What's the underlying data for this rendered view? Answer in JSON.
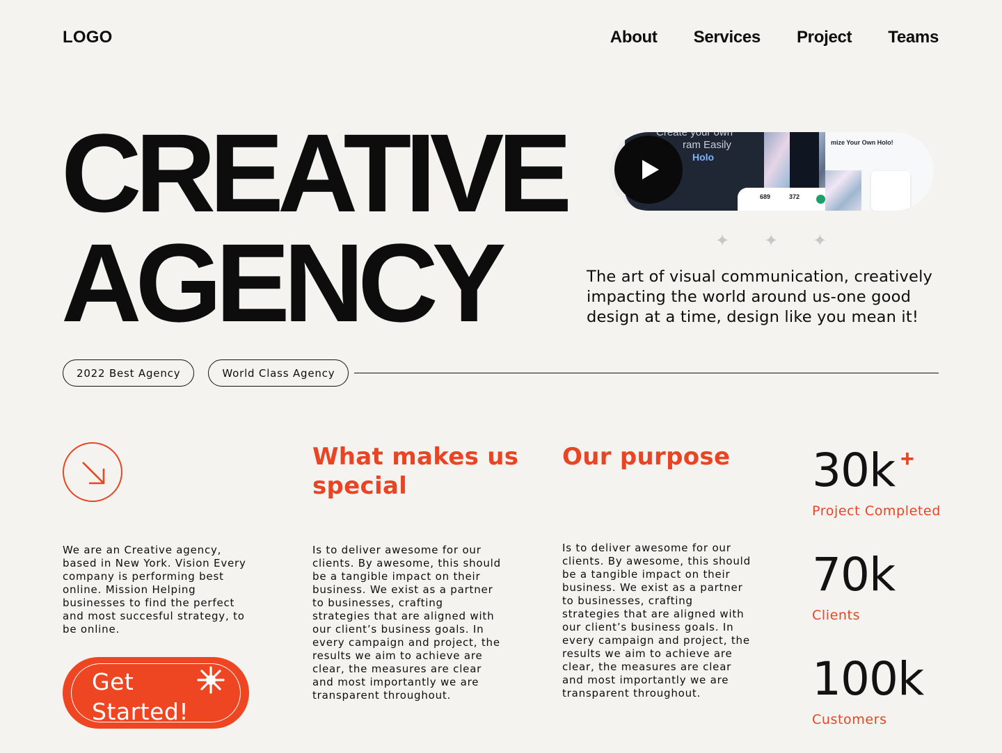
{
  "header": {
    "logo": "LOGO",
    "nav": [
      "About",
      "Services",
      "Project",
      "Teams"
    ]
  },
  "hero": {
    "title_line1": "CREATIVE",
    "title_line2": "AGENCY",
    "tagline": "The art of visual communication, creatively impacting the world around us-one good design at a time, design like you mean it!"
  },
  "video_preview": {
    "line1": "Create your own",
    "line2": "ram Easily",
    "line3": "Holo",
    "stat1": "689",
    "stat2": "372",
    "right_title": "mize Your Own Holo!"
  },
  "badges": [
    "2022 Best Agency",
    "World Class Agency"
  ],
  "about": {
    "text": "We are an Creative agency, based in New York. Vision Every company is performing best online. Mission Helping businesses to find the perfect and most succesful strategy, to be online."
  },
  "cta": {
    "label": "Get Started!"
  },
  "special": {
    "heading": "What makes us special",
    "text": "Is to deliver awesome for our clients. By awesome, this should be a tangible impact on their business. We exist as a partner to businesses, crafting strategies that are aligned with our client’s business goals. In every campaign and project, the results we aim to achieve are clear, the measures are clear and most importantly we are transparent throughout."
  },
  "purpose": {
    "heading": "Our purpose",
    "text": "Is to deliver awesome for our clients. By awesome, this should be a tangible impact on their business. We exist as a partner to businesses, crafting strategies that are aligned with our client’s business goals. In every campaign and project, the results we aim to achieve are clear, the measures are clear and most importantly we are transparent throughout."
  },
  "stats": [
    {
      "value": "30k",
      "suffix": "+",
      "label": "Project Completed"
    },
    {
      "value": "70k",
      "label": "Clients"
    },
    {
      "value": "100k",
      "label": "Customers"
    }
  ],
  "colors": {
    "accent": "#e94423",
    "background": "#f4f3f0",
    "text": "#0d0d0d"
  }
}
